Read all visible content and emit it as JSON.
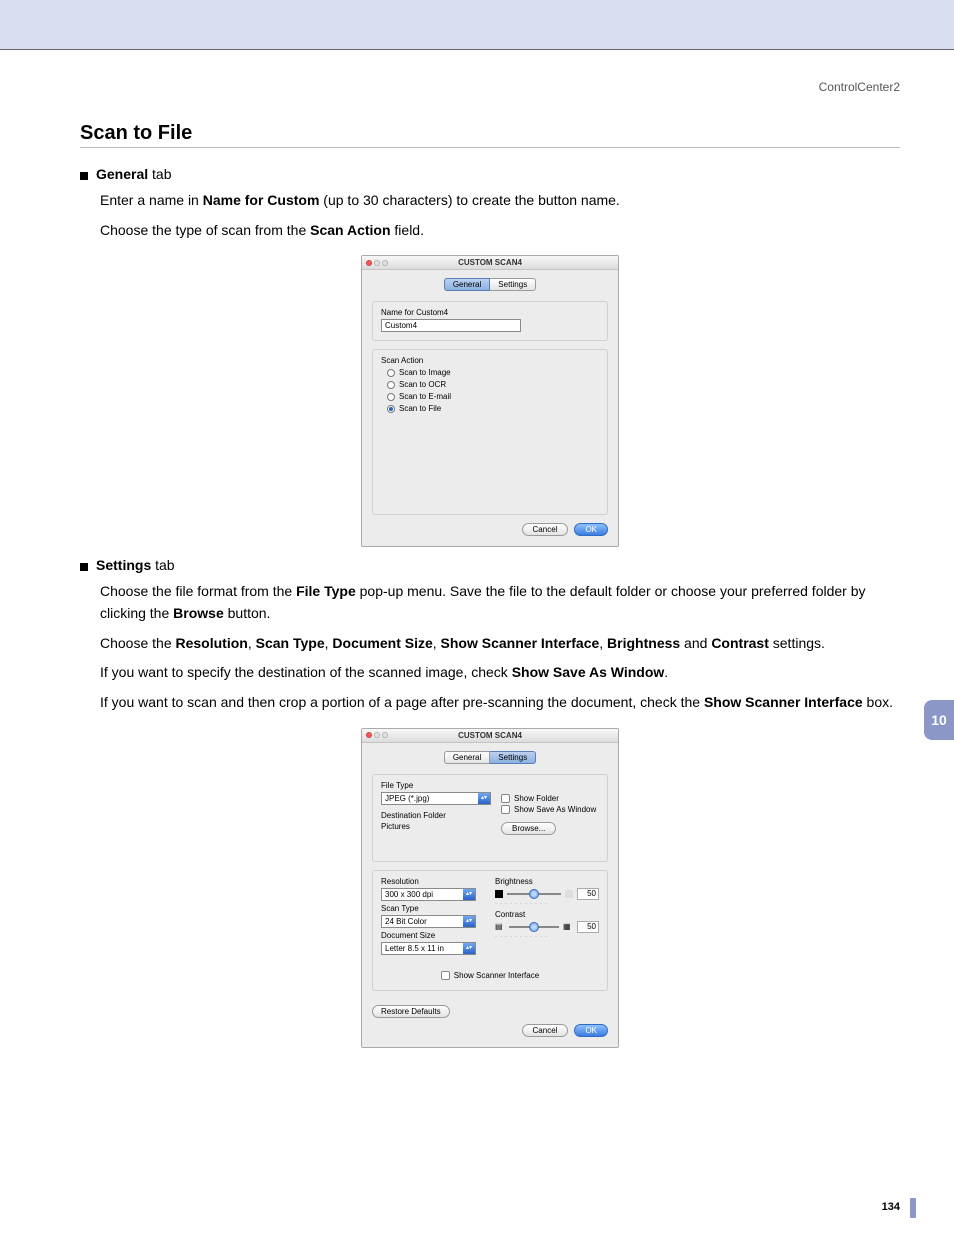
{
  "breadcrumb": "ControlCenter2",
  "section_title": "Scan to File",
  "bullets": {
    "general": {
      "bold": "General",
      "rest": " tab"
    },
    "settings": {
      "bold": "Settings",
      "rest": " tab"
    }
  },
  "paragraphs": {
    "p1a": "Enter a name in ",
    "p1b": "Name for Custom",
    "p1c": " (up to 30 characters) to create the button name.",
    "p2a": "Choose the type of scan from the ",
    "p2b": "Scan Action",
    "p2c": " field.",
    "p3a": "Choose the file format from the ",
    "p3b": "File Type",
    "p3c": " pop-up menu. Save the file to the default folder or choose your preferred folder by clicking the ",
    "p3d": "Browse",
    "p3e": " button.",
    "p4a": "Choose the ",
    "p4b": "Resolution",
    "p4c": ", ",
    "p4d": "Scan Type",
    "p4e": ", ",
    "p4f": "Document Size",
    "p4g": ", ",
    "p4h": "Show Scanner Interface",
    "p4i": ", ",
    "p4j": "Brightness",
    "p4k": " and ",
    "p4l": "Contrast",
    "p4m": " settings.",
    "p5a": "If you want to specify the destination of the scanned image, check ",
    "p5b": "Show Save As Window",
    "p5c": ".",
    "p6a": "If you want to scan and then crop a portion of a page after pre-scanning the document, check the ",
    "p6b": "Show Scanner Interface",
    "p6c": " box."
  },
  "dialog1": {
    "title": "CUSTOM SCAN4",
    "tabs": {
      "general": "General",
      "settings": "Settings"
    },
    "name_label": "Name for Custom4",
    "name_value": "Custom4",
    "action_label": "Scan Action",
    "radios": {
      "image": "Scan to Image",
      "ocr": "Scan to OCR",
      "email": "Scan to E-mail",
      "file": "Scan to File"
    },
    "cancel": "Cancel",
    "ok": "OK"
  },
  "dialog2": {
    "title": "CUSTOM SCAN4",
    "tabs": {
      "general": "General",
      "settings": "Settings"
    },
    "file_type_label": "File Type",
    "file_type_value": "JPEG (*.jpg)",
    "show_folder": "Show Folder",
    "show_save_as": "Show Save As Window",
    "dest_label": "Destination Folder",
    "dest_value": "Pictures",
    "browse": "Browse...",
    "resolution_label": "Resolution",
    "resolution_value": "300 x 300 dpi",
    "scan_type_label": "Scan Type",
    "scan_type_value": "24 Bit Color",
    "doc_size_label": "Document Size",
    "doc_size_value": "Letter  8.5 x 11 in",
    "brightness_label": "Brightness",
    "brightness_value": "50",
    "contrast_label": "Contrast",
    "contrast_value": "50",
    "show_scanner": "Show Scanner Interface",
    "restore": "Restore Defaults",
    "cancel": "Cancel",
    "ok": "OK"
  },
  "side_tab": "10",
  "page_number": "134"
}
